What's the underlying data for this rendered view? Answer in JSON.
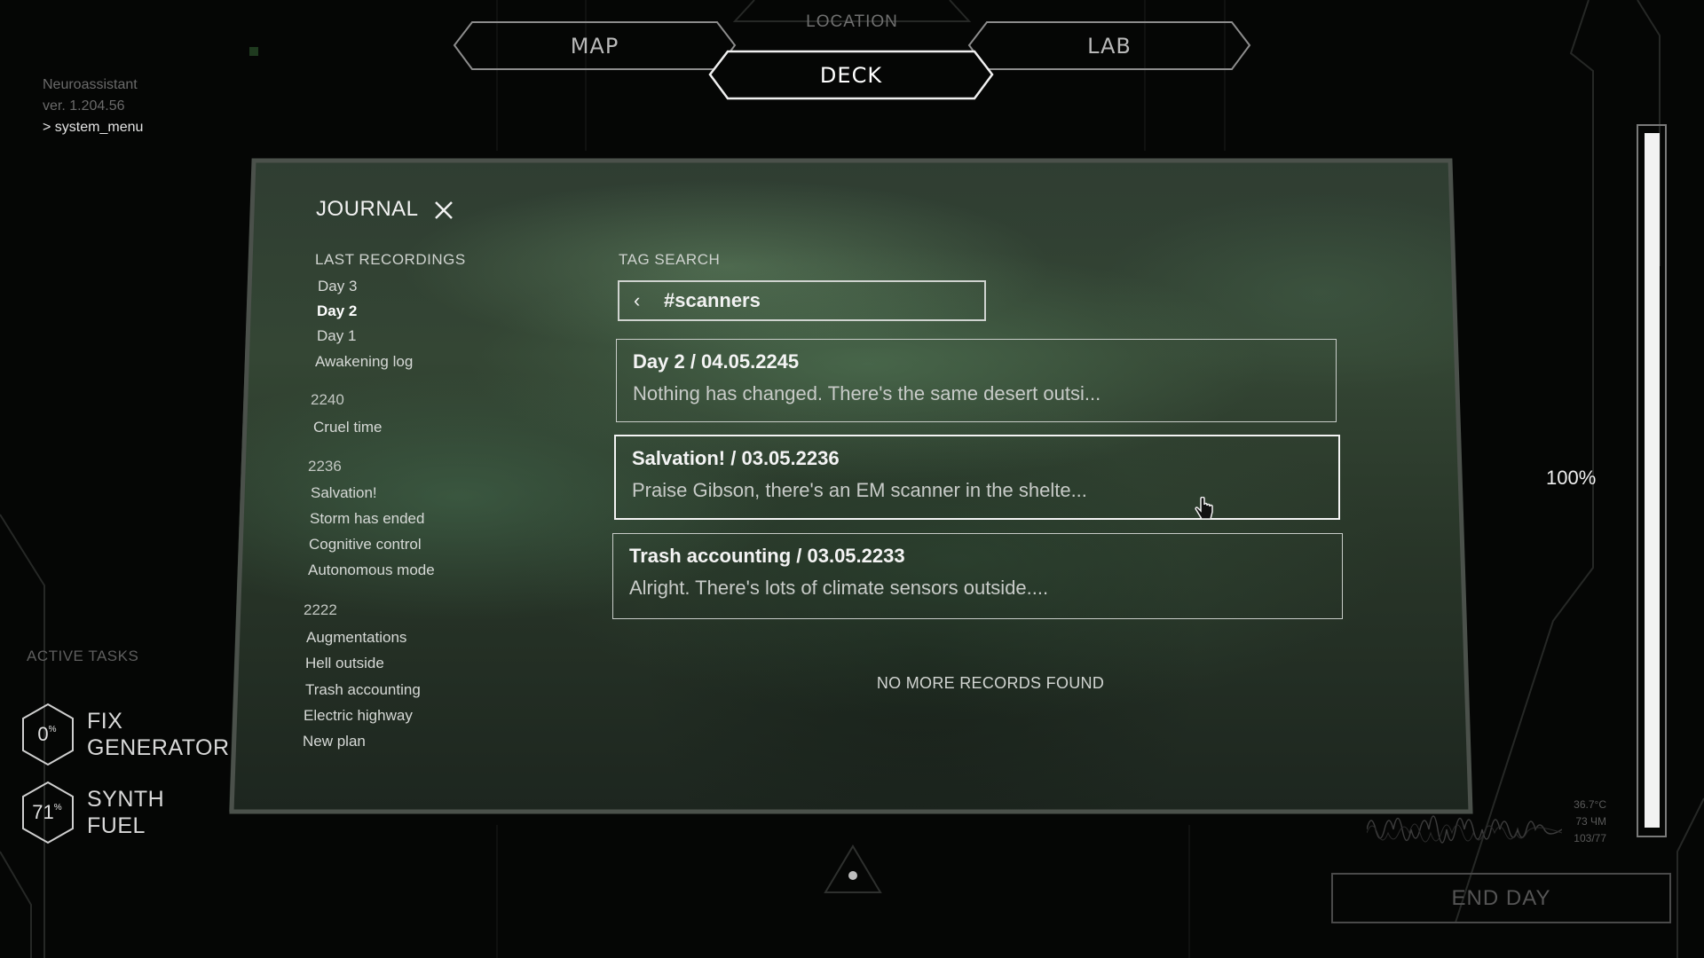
{
  "nav": {
    "location_label": "LOCATION",
    "tabs": [
      {
        "label": "MAP",
        "active": false
      },
      {
        "label": "DECK",
        "active": true
      },
      {
        "label": "LAB",
        "active": false
      }
    ]
  },
  "neuroassistant": {
    "name": "Neuroassistant",
    "version": "ver. 1.204.56",
    "command": "> system_menu"
  },
  "journal": {
    "title": "JOURNAL",
    "close_icon": "close-icon",
    "sidebar": {
      "heading": "LAST RECORDINGS",
      "recent": [
        {
          "label": "Day 3",
          "active": false
        },
        {
          "label": "Day 2",
          "active": true
        },
        {
          "label": "Day 1",
          "active": false
        },
        {
          "label": "Awakening log",
          "active": false
        }
      ],
      "groups": [
        {
          "year": "2240",
          "items": [
            "Cruel time"
          ]
        },
        {
          "year": "2236",
          "items": [
            "Salvation!",
            "Storm has ended",
            "Cognitive control",
            "Autonomous mode"
          ]
        },
        {
          "year": "2222",
          "items": [
            "Augmentations",
            "Hell outside",
            "Trash accounting",
            "Electric highway",
            "New plan"
          ]
        }
      ]
    },
    "tag_search": {
      "label": "TAG SEARCH",
      "back_glyph": "‹",
      "value": "#scanners"
    },
    "records": [
      {
        "title": "Day 2 / 04.05.2245",
        "preview": "Nothing has changed. There's the same desert outsi..."
      },
      {
        "title": "Salvation! / 03.05.2236",
        "preview": "Praise Gibson, there's an EM scanner in the shelte..."
      },
      {
        "title": "Trash accounting / 03.05.2233",
        "preview": "Alright. There's lots of climate sensors outside...."
      }
    ],
    "hovered_record": 1,
    "empty_note": "NO MORE RECORDS FOUND"
  },
  "active_tasks": {
    "heading": "ACTIVE TASKS",
    "tasks": [
      {
        "percent": "0",
        "percent_sign": "%",
        "name_line1": "FIX",
        "name_line2": "GENERATOR",
        "progress": 0
      },
      {
        "percent": "71",
        "percent_sign": "%",
        "name_line1": "SYNTH",
        "name_line2": "FUEL",
        "progress": 0.71
      }
    ]
  },
  "gauge": {
    "percent_label": "100%",
    "level": 1.0
  },
  "readout": {
    "temperature": "36.7°C",
    "line2": "73 ЧМ",
    "line3": "103/77"
  },
  "end_day": {
    "label": "END DAY"
  },
  "colors": {
    "panel_green": "#344634",
    "text_light": "#f2f2f2",
    "muted": "#6a6a6a",
    "background": "#050605"
  }
}
